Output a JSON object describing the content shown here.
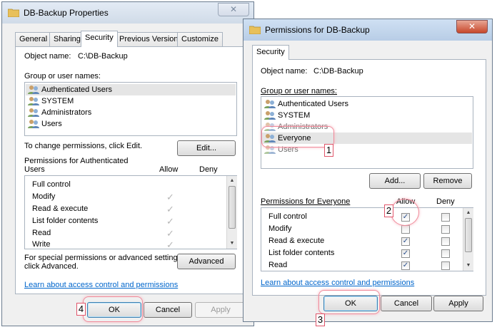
{
  "props": {
    "title": "DB-Backup Properties",
    "close_label": "✕",
    "tabs": [
      "General",
      "Sharing",
      "Security",
      "Previous Versions",
      "Customize"
    ],
    "object_name_label": "Object name:",
    "object_name_value": "C:\\DB-Backup",
    "group_label": "Group or user names:",
    "users": [
      "Authenticated Users",
      "SYSTEM",
      "Administrators",
      "Users"
    ],
    "change_hint": "To change permissions, click Edit.",
    "edit_label": "Edit...",
    "perms_for_line1": "Permissions for Authenticated",
    "perms_for_line2": "Users",
    "allow_label": "Allow",
    "deny_label": "Deny",
    "permissions": [
      "Full control",
      "Modify",
      "Read & execute",
      "List folder contents",
      "Read",
      "Write"
    ],
    "allow_states": [
      false,
      true,
      true,
      true,
      true,
      true
    ],
    "special_line1": "For special permissions or advanced settings,",
    "special_line2": "click Advanced.",
    "advanced_label": "Advanced",
    "learn_link": "Learn about access control and permissions",
    "ok_label": "OK",
    "cancel_label": "Cancel",
    "apply_label": "Apply"
  },
  "perms": {
    "title": "Permissions for DB-Backup",
    "close_label": "✕",
    "tab": "Security",
    "object_name_label": "Object name:",
    "object_name_value": "C:\\DB-Backup",
    "group_label": "Group or user names:",
    "users": [
      "Authenticated Users",
      "SYSTEM",
      "Administrators",
      "Everyone",
      "Users"
    ],
    "selected_user": "Everyone",
    "add_label": "Add...",
    "remove_label": "Remove",
    "perms_for": "Permissions for Everyone",
    "allow_label": "Allow",
    "deny_label": "Deny",
    "permissions": [
      "Full control",
      "Modify",
      "Read & execute",
      "List folder contents",
      "Read"
    ],
    "allow_states": [
      true,
      false,
      true,
      true,
      true
    ],
    "deny_states": [
      false,
      false,
      false,
      false,
      false
    ],
    "learn_link": "Learn about access control and permissions",
    "ok_label": "OK",
    "cancel_label": "Cancel",
    "apply_label": "Apply"
  },
  "annotations": {
    "step1": "1",
    "step2": "2",
    "step3": "3",
    "step4": "4"
  },
  "colors": {
    "link": "#0066cc",
    "highlight": "#f08a9a",
    "selection": "#e5e5e5"
  }
}
